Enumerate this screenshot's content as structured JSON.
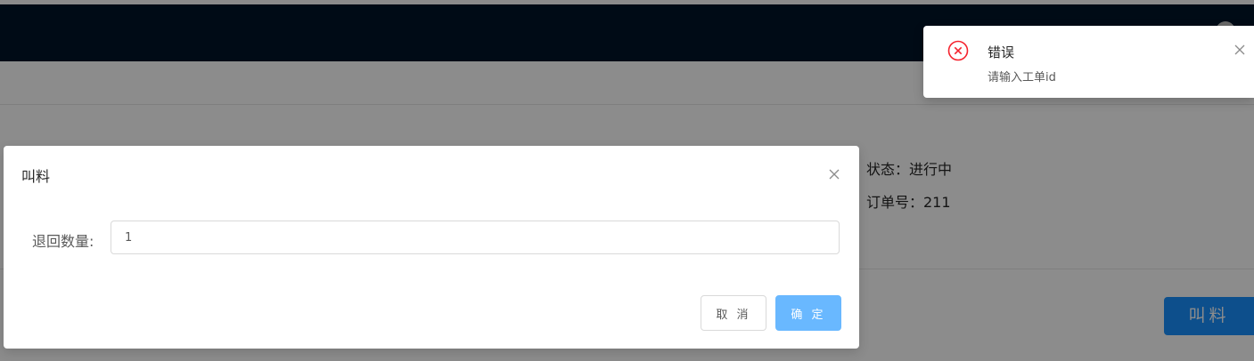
{
  "page": {
    "info": {
      "status": "状态：进行中",
      "order_no": "订单号：211"
    },
    "call_button_label": "叫料"
  },
  "modal": {
    "title": "叫料",
    "field_label": "退回数量:",
    "field_value": "1",
    "cancel_label": "取 消",
    "ok_label": "确 定"
  },
  "notification": {
    "title": "错误",
    "description": "请输入工单id",
    "icon": "close-circle-icon",
    "color": "#f5222d"
  },
  "colors": {
    "header_bg": "#001529",
    "primary": "#1890ff",
    "primary_disabled": "#69b8ff"
  }
}
